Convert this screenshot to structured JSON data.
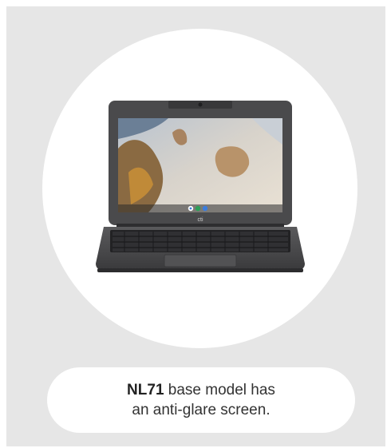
{
  "product": {
    "model_name": "NL71",
    "caption_line1_rest": " base model has",
    "caption_line2": "an anti-glare screen.",
    "brand_mark": "cti"
  },
  "colors": {
    "background": "#e6e6e6",
    "circle": "#ffffff",
    "pill": "#ffffff",
    "laptop_body": "#4a4a4c",
    "text": "#333333"
  },
  "icons": [
    "laptop-image",
    "chrome-icon",
    "files-icon",
    "play-store-icon"
  ]
}
